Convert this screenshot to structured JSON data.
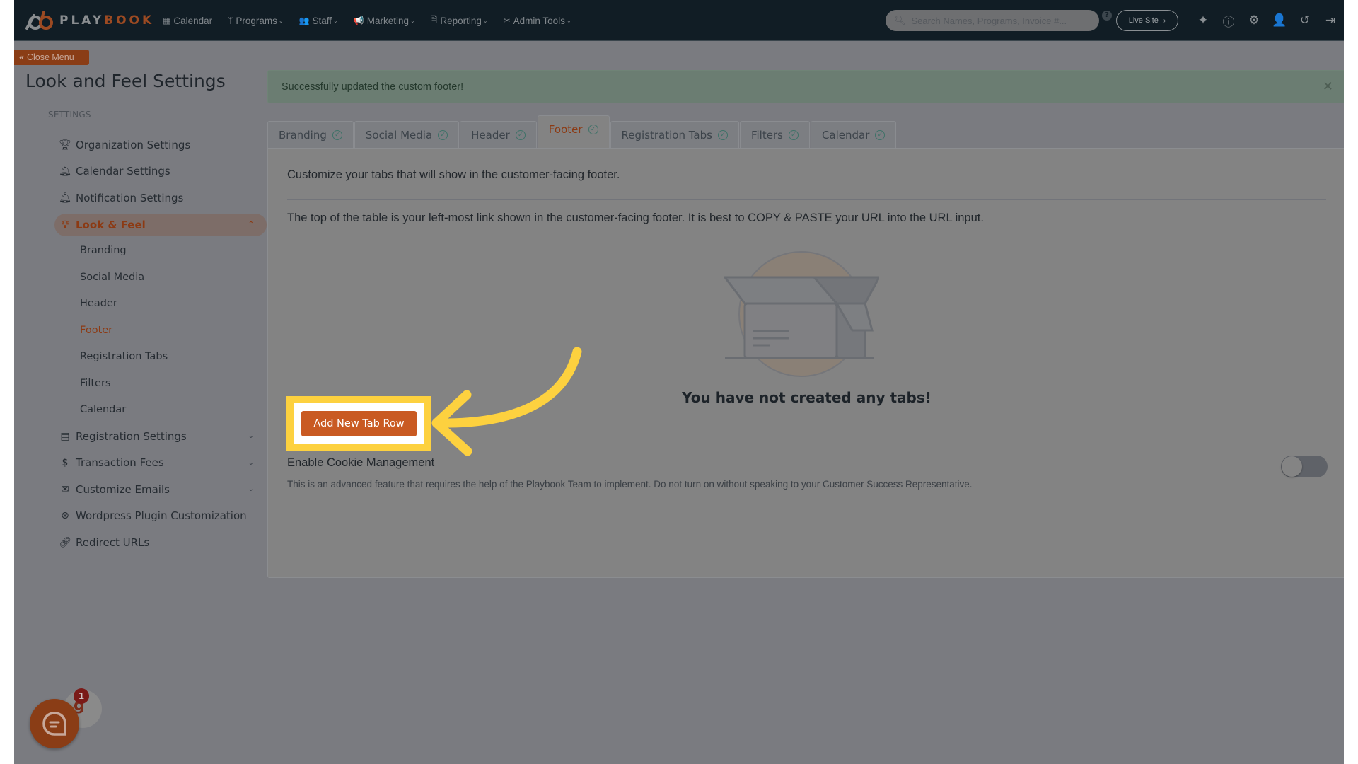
{
  "header": {
    "brand": {
      "play": "PLAY",
      "book": "BOOK"
    },
    "nav": [
      {
        "label": "Calendar",
        "icon": "calendar-icon",
        "dropdown": false
      },
      {
        "label": "Programs",
        "icon": "branch-icon",
        "dropdown": true
      },
      {
        "label": "Staff",
        "icon": "users-icon",
        "dropdown": true
      },
      {
        "label": "Marketing",
        "icon": "megaphone-icon",
        "dropdown": true
      },
      {
        "label": "Reporting",
        "icon": "document-icon",
        "dropdown": true
      },
      {
        "label": "Admin Tools",
        "icon": "tools-icon",
        "dropdown": true
      }
    ],
    "search_placeholder": "Search Names, Programs, Invoice #...",
    "live_site_label": "Live Site",
    "icons": [
      "announcement-icon",
      "help-icon",
      "gear-icon",
      "add-user-icon",
      "history-icon",
      "logout-icon"
    ]
  },
  "sidebar": {
    "close_menu_label": "Close Menu",
    "page_title": "Look and Feel Settings",
    "section_label": "SETTINGS",
    "items": [
      {
        "label": "Organization Settings",
        "icon": "trophy-icon"
      },
      {
        "label": "Calendar Settings",
        "icon": "bell-icon"
      },
      {
        "label": "Notification Settings",
        "icon": "bell-icon"
      },
      {
        "label": "Look & Feel",
        "icon": "lightbulb-icon",
        "active": true,
        "expanded": true
      },
      {
        "label": "Registration Settings",
        "icon": "form-icon",
        "expandable": true
      },
      {
        "label": "Transaction Fees",
        "icon": "dollar-icon",
        "expandable": true
      },
      {
        "label": "Customize Emails",
        "icon": "envelope-icon",
        "expandable": true
      },
      {
        "label": "Wordpress Plugin Customization",
        "icon": "wordpress-icon"
      },
      {
        "label": "Redirect URLs",
        "icon": "link-icon"
      }
    ],
    "sub_items": [
      {
        "label": "Branding"
      },
      {
        "label": "Social Media"
      },
      {
        "label": "Header"
      },
      {
        "label": "Footer",
        "current": true
      },
      {
        "label": "Registration Tabs"
      },
      {
        "label": "Filters"
      },
      {
        "label": "Calendar"
      }
    ]
  },
  "main": {
    "alert_message": "Successfully updated the custom footer!",
    "tabs": [
      {
        "label": "Branding",
        "complete": true
      },
      {
        "label": "Social Media",
        "complete": true
      },
      {
        "label": "Header",
        "complete": true
      },
      {
        "label": "Footer",
        "complete": true,
        "active": true
      },
      {
        "label": "Registration Tabs",
        "complete": true
      },
      {
        "label": "Filters",
        "complete": true
      },
      {
        "label": "Calendar",
        "complete": true
      }
    ],
    "intro": "Customize your tabs that will show in the customer-facing footer.",
    "note": "The top of the table is your left-most link shown in the customer-facing footer. It is best to COPY & PASTE your URL into the URL input.",
    "empty_message": "You have not created any tabs!",
    "add_button_label": "Add New Tab Row",
    "cookie": {
      "title": "Enable Cookie Management",
      "description": "This is an advanced feature that requires the help of the Playbook Team to implement. Do not turn on without speaking to your Customer Success Representative.",
      "enabled": false
    }
  },
  "chat": {
    "badge_count": "1"
  },
  "colors": {
    "accent": "#c95a22",
    "highlight": "#fdd13f",
    "header_bg": "#111d25",
    "success_check": "#3f7268"
  }
}
